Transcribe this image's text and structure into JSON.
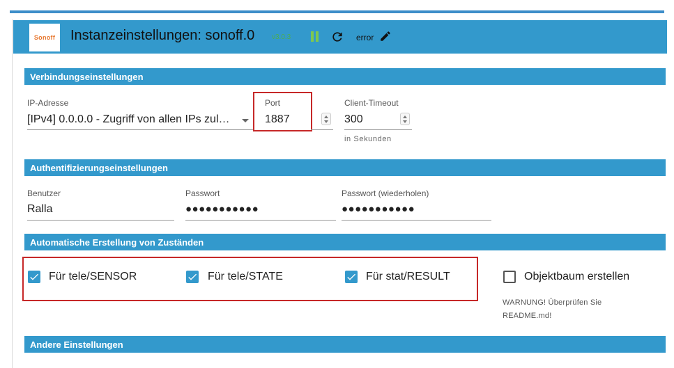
{
  "header": {
    "logo_text": "Sonoff",
    "title": "Instanzeinstellungen: sonoff.0",
    "version": "v3.0.3",
    "status": "error",
    "icons": [
      "pause-icon",
      "refresh-icon",
      "pencil-icon"
    ]
  },
  "sections": {
    "connection": "Verbindungseinstellungen",
    "auth": "Authentifizierungseinstellungen",
    "auto_states": "Automatische Erstellung von Zuständen",
    "other": "Andere Einstellungen"
  },
  "connection": {
    "ip_label": "IP-Adresse",
    "ip_value": "[IPv4] 0.0.0.0 - Zugriff von allen IPs zul…",
    "port_label": "Port",
    "port_value": "1887",
    "timeout_label": "Client-Timeout",
    "timeout_value": "300",
    "timeout_helper": "in Sekunden"
  },
  "auth": {
    "user_label": "Benutzer",
    "user_value": "Ralla",
    "password_label": "Passwort",
    "password_value": "●●●●●●●●●●●",
    "password_repeat_label": "Passwort (wiederholen)",
    "password_repeat_value": "●●●●●●●●●●●"
  },
  "auto_states": {
    "checkboxes": [
      {
        "label": "Für tele/SENSOR",
        "checked": true
      },
      {
        "label": "Für tele/STATE",
        "checked": true
      },
      {
        "label": "Für stat/RESULT",
        "checked": true
      },
      {
        "label": "Objektbaum erstellen",
        "checked": false
      }
    ],
    "warning": "WARNUNG! Überprüfen Sie README.md!"
  },
  "colors": {
    "accent": "#3399cc",
    "highlight": "#c62828",
    "version": "#4caf50",
    "pause": "#7ec850",
    "logo": "#e8772e"
  }
}
